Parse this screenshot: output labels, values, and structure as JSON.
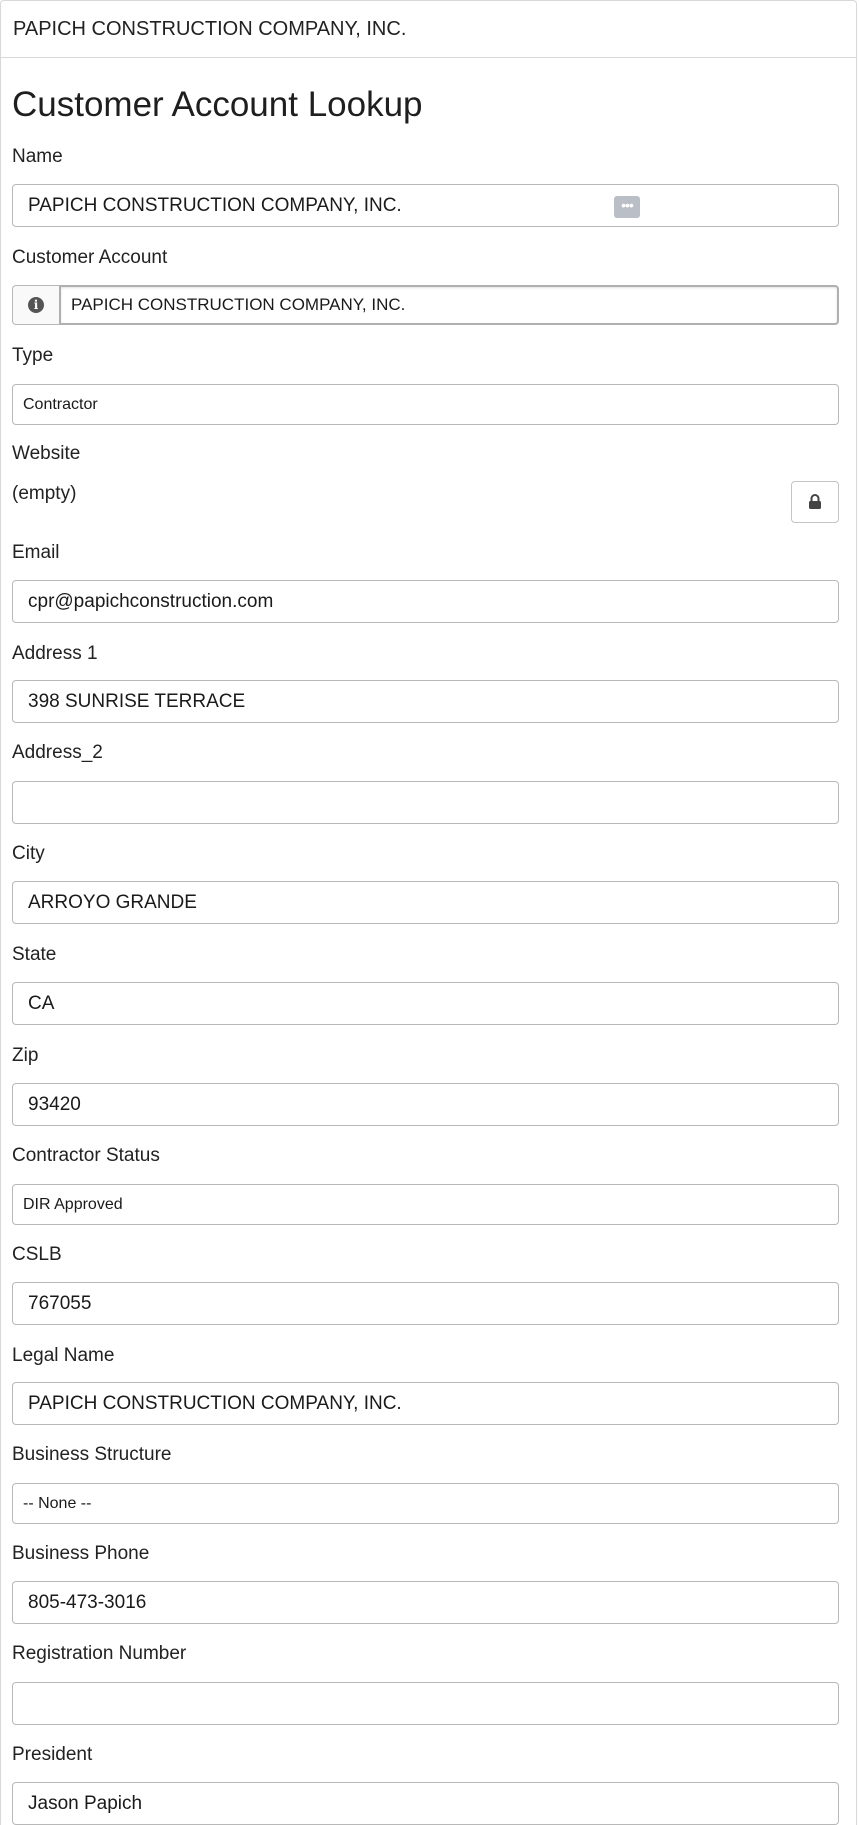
{
  "header": {
    "account_name": "PAPICH CONSTRUCTION COMPANY, INC."
  },
  "page": {
    "title": "Customer Account Lookup"
  },
  "form": {
    "name": {
      "label": "Name",
      "value": "PAPICH CONSTRUCTION COMPANY, INC."
    },
    "customer_account": {
      "label": "Customer Account",
      "value": "PAPICH CONSTRUCTION COMPANY, INC."
    },
    "type": {
      "label": "Type",
      "value": "Contractor"
    },
    "website": {
      "label": "Website",
      "value": "(empty)"
    },
    "email": {
      "label": "Email",
      "value": "cpr@papichconstruction.com"
    },
    "address1": {
      "label": "Address 1",
      "value": "398 SUNRISE TERRACE"
    },
    "address2": {
      "label": "Address_2",
      "value": ""
    },
    "city": {
      "label": "City",
      "value": "ARROYO GRANDE"
    },
    "state": {
      "label": "State",
      "value": "CA"
    },
    "zip": {
      "label": "Zip",
      "value": "93420"
    },
    "contractor_status": {
      "label": "Contractor Status",
      "value": "DIR Approved"
    },
    "cslb": {
      "label": "CSLB",
      "value": "767055"
    },
    "legal_name": {
      "label": "Legal Name",
      "value": "PAPICH CONSTRUCTION COMPANY, INC."
    },
    "business_structure": {
      "label": "Business Structure",
      "value": "-- None --"
    },
    "business_phone": {
      "label": "Business Phone",
      "value": "805-473-3016"
    },
    "registration_number": {
      "label": "Registration Number",
      "value": ""
    },
    "president": {
      "label": "President",
      "value": "Jason Papich"
    }
  },
  "icons": {
    "name_field_action": "more-dots-icon",
    "account_info": "info-icon",
    "website_lock": "lock-icon"
  }
}
